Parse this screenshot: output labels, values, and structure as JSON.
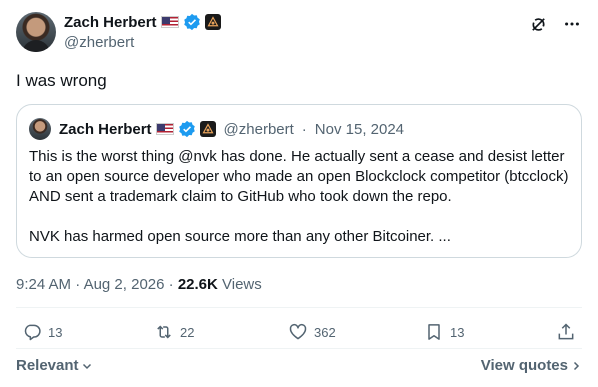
{
  "author": {
    "name": "Zach Herbert",
    "handle": "@zherbert"
  },
  "post": {
    "text": "I was wrong",
    "time": "9:24 AM",
    "date": "Aug 2, 2026",
    "views_count": "22.6K",
    "views_label": "Views",
    "dot": "·"
  },
  "quote": {
    "name": "Zach Herbert",
    "handle": "@zherbert",
    "date": "Nov 15, 2024",
    "dot": "·",
    "paragraph1": "This is the worst thing @nvk has done. He actually sent a cease and desist letter to an open source developer who made an open Blockclock competitor (btcclock) AND sent a trademark claim to GitHub who took down the repo.",
    "paragraph2": "NVK has harmed open source more than any other Bitcoiner. ..."
  },
  "actions": {
    "replies": "13",
    "reposts": "22",
    "likes": "362",
    "bookmarks": "13"
  },
  "footer": {
    "sort_label": "Relevant",
    "view_quotes_label": "View quotes"
  },
  "colors": {
    "text": "#0f1419",
    "secondary": "#536471",
    "verified": "#1d9bf0",
    "border": "#cfd9de"
  },
  "icons": [
    "verified-badge-icon",
    "us-flag-icon",
    "affiliate-badge-icon",
    "grok-icon",
    "more-icon",
    "reply-icon",
    "repost-icon",
    "like-icon",
    "bookmark-icon",
    "share-icon",
    "chevron-down-icon",
    "chevron-right-icon"
  ]
}
